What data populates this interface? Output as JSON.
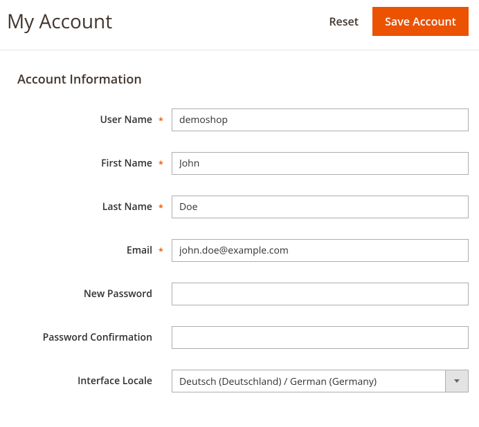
{
  "header": {
    "title": "My Account",
    "reset_label": "Reset",
    "save_label": "Save Account"
  },
  "section": {
    "title": "Account Information"
  },
  "form": {
    "username": {
      "label": "User Name",
      "value": "demoshop"
    },
    "firstname": {
      "label": "First Name",
      "value": "John"
    },
    "lastname": {
      "label": "Last Name",
      "value": "Doe"
    },
    "email": {
      "label": "Email",
      "value": "john.doe@example.com"
    },
    "new_password": {
      "label": "New Password",
      "value": ""
    },
    "password_confirmation": {
      "label": "Password Confirmation",
      "value": ""
    },
    "interface_locale": {
      "label": "Interface Locale",
      "value": "Deutsch (Deutschland) / German (Germany)"
    }
  }
}
